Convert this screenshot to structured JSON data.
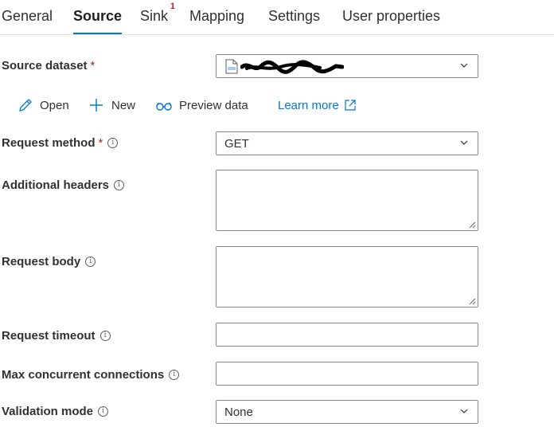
{
  "tabs": [
    {
      "label": "General"
    },
    {
      "label": "Source",
      "active": true
    },
    {
      "label": "Sink",
      "badge": "1"
    },
    {
      "label": "Mapping"
    },
    {
      "label": "Settings"
    },
    {
      "label": "User properties"
    }
  ],
  "source_dataset": {
    "label": "Source dataset",
    "required_mark": "*",
    "value_icon": "json-file-icon",
    "value_redacted": true
  },
  "toolbar": {
    "open": "Open",
    "new": "New",
    "preview": "Preview data",
    "learn_more": "Learn more"
  },
  "fields": {
    "request_method": {
      "label": "Request method",
      "required_mark": "*",
      "value": "GET"
    },
    "additional_headers": {
      "label": "Additional headers",
      "value": ""
    },
    "request_body": {
      "label": "Request body",
      "value": ""
    },
    "request_timeout": {
      "label": "Request timeout",
      "value": ""
    },
    "max_concurrent": {
      "label": "Max concurrent connections",
      "value": ""
    },
    "validation_mode": {
      "label": "Validation mode",
      "value": "None"
    }
  },
  "info_glyph": "i",
  "colors": {
    "accent": "#0078d4",
    "required": "#a4262c",
    "border": "#8a8886",
    "text": "#323130"
  }
}
